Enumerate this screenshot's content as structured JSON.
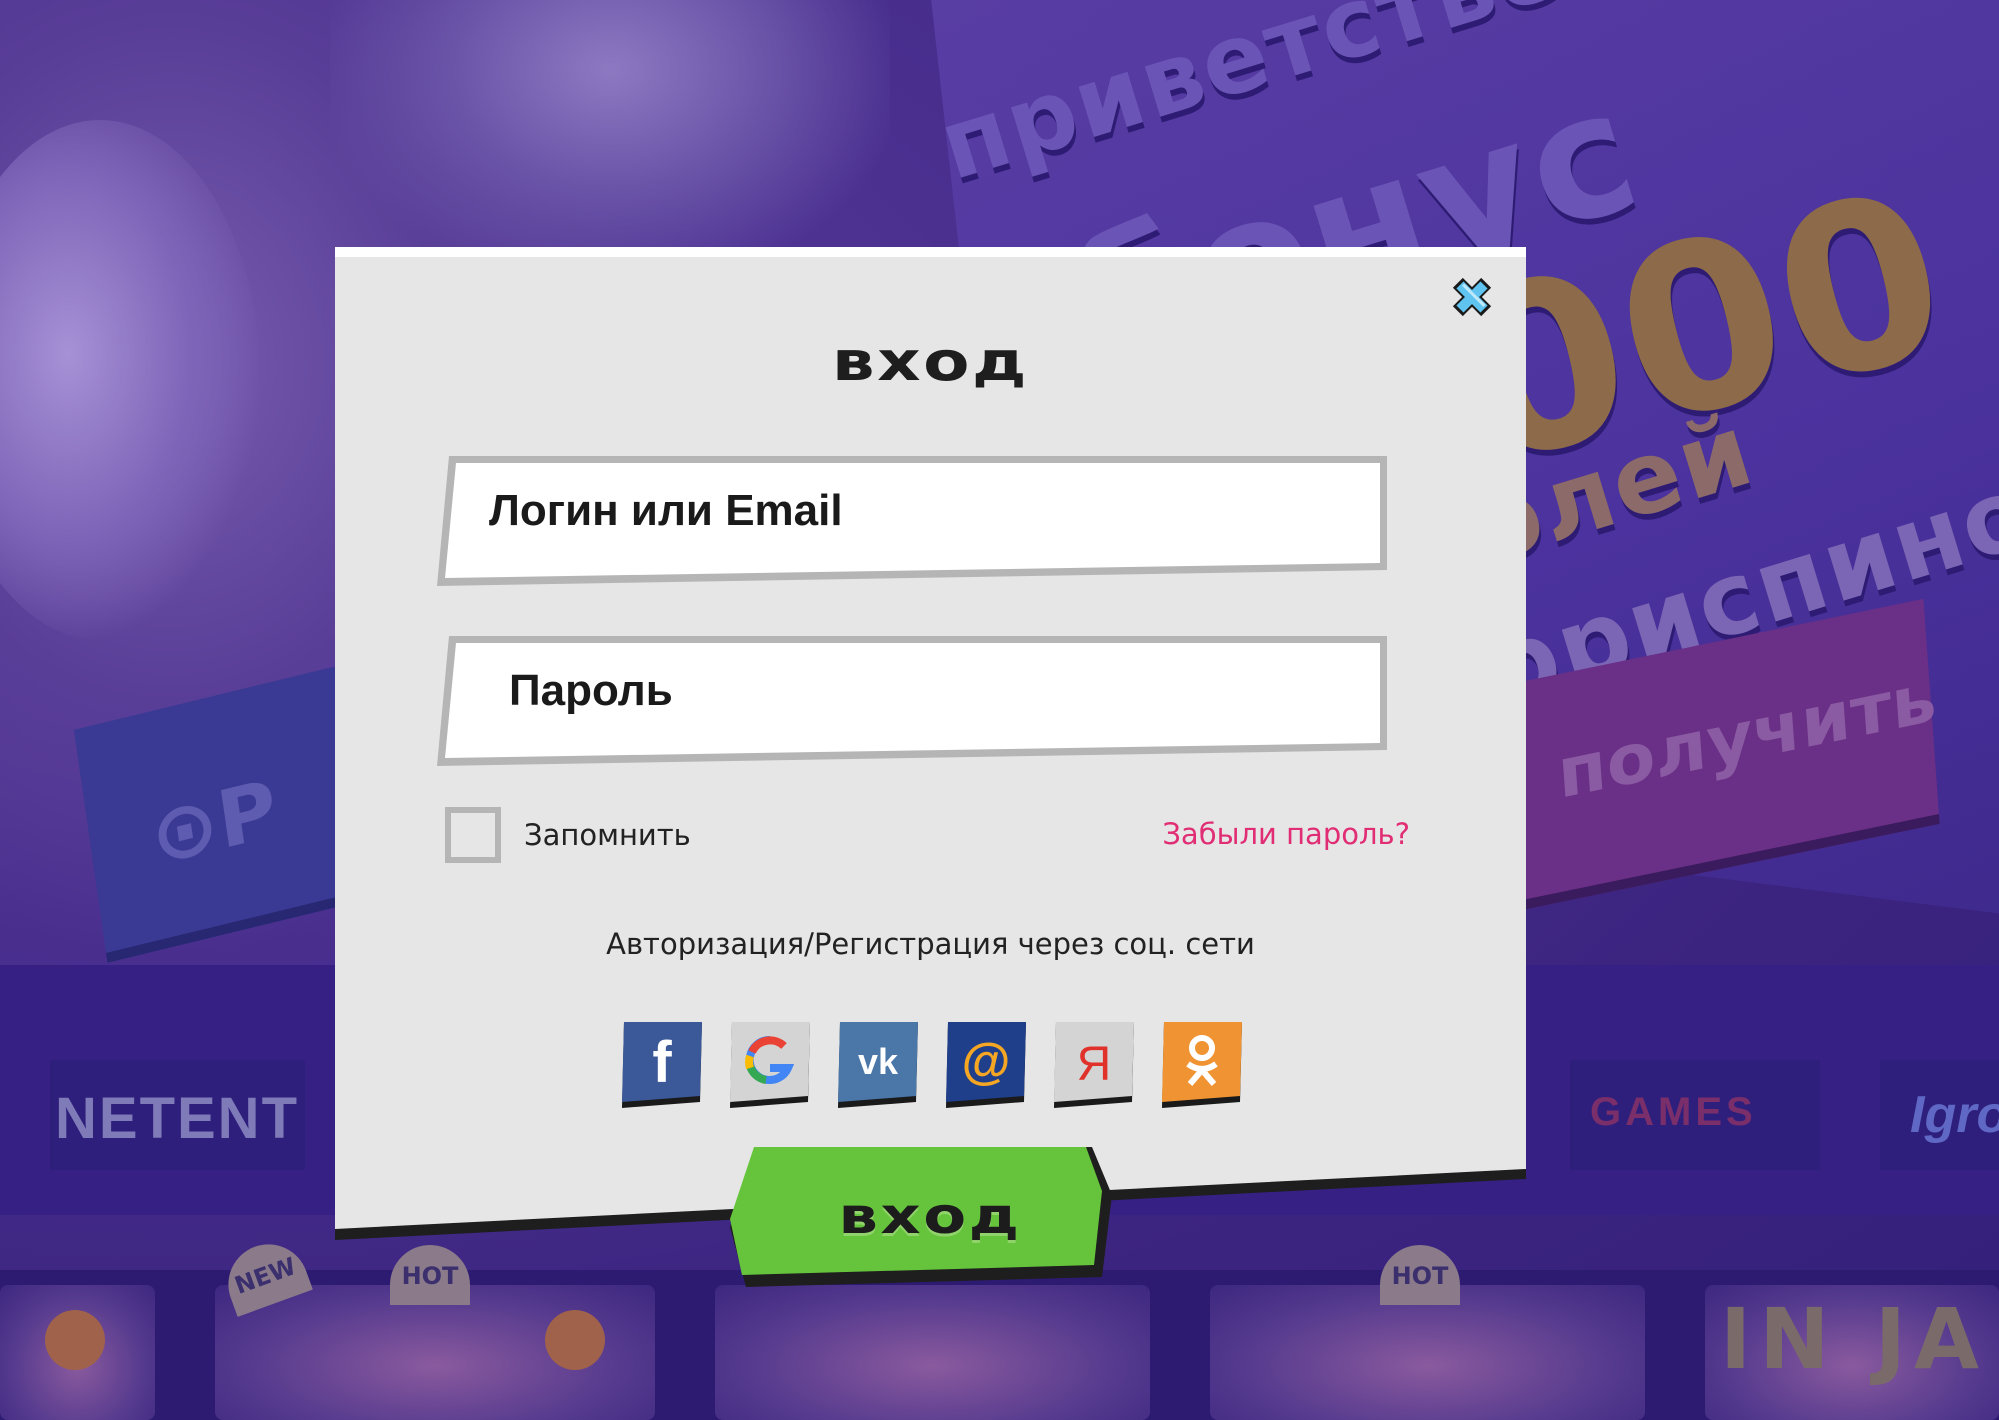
{
  "modal": {
    "title": "вход",
    "login_placeholder": "Логин или Email",
    "password_placeholder": "Пароль",
    "remember_label": "Запомнить",
    "remember_checked": false,
    "forgot_link": "Забыли пароль?",
    "social_caption": "Авторизация/Регистрация через соц. сети",
    "social_buttons": [
      {
        "name": "facebook",
        "glyph": "f",
        "color": "#3b5998"
      },
      {
        "name": "google",
        "glyph": "G",
        "color": "#dcdcdc"
      },
      {
        "name": "vk",
        "glyph": "vk",
        "color": "#4a76a8"
      },
      {
        "name": "mailru",
        "glyph": "@",
        "color": "#1f3f8a"
      },
      {
        "name": "yandex",
        "glyph": "Я",
        "color": "#d9d9d9"
      },
      {
        "name": "odnoklassniki",
        "glyph": "ok",
        "color": "#f09433"
      }
    ],
    "submit_label": "вход"
  },
  "background": {
    "promo_lines": [
      "приветствен",
      "бонус",
      "000",
      "блей",
      "фриспино"
    ],
    "promo_button": "получить",
    "providers": [
      "NETENT",
      "GAMES",
      "Igro"
    ],
    "badges": [
      "NEW",
      "HOT",
      "HOT"
    ],
    "game_title": "IN JA"
  },
  "colors": {
    "accent_green": "#66c43c",
    "link_pink": "#e02d74",
    "modal_bg": "#e6e6e6",
    "field_border": "#b5b5b5"
  }
}
